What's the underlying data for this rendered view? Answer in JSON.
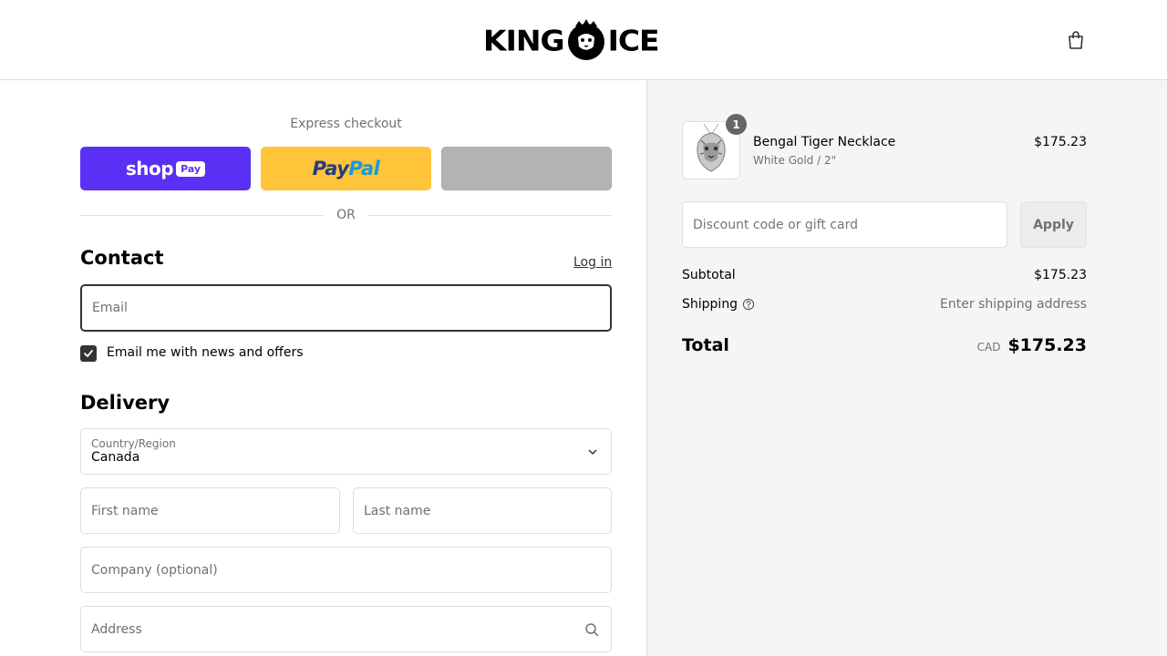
{
  "brand": {
    "name": "KING ICE",
    "left": "KING",
    "right": "ICE"
  },
  "header": {
    "cart_icon": "shopping-bag-icon"
  },
  "express": {
    "title": "Express checkout",
    "shoppay_word": "shop",
    "shoppay_badge": "Pay",
    "paypal_a": "Pay",
    "paypal_b": "Pal",
    "or": "OR"
  },
  "contact": {
    "title": "Contact",
    "login": "Log in",
    "email_placeholder": "Email",
    "newsletter_label": "Email me with news and offers",
    "newsletter_checked": true
  },
  "delivery": {
    "title": "Delivery",
    "country_label": "Country/Region",
    "country_value": "Canada",
    "first_name_placeholder": "First name",
    "last_name_placeholder": "Last name",
    "company_placeholder": "Company (optional)",
    "address_placeholder": "Address"
  },
  "summary": {
    "product": {
      "name": "Bengal Tiger Necklace",
      "variant": "White Gold / 2\"",
      "price": "$175.23",
      "quantity": "1"
    },
    "discount_placeholder": "Discount code or gift card",
    "apply_label": "Apply",
    "subtotal_label": "Subtotal",
    "subtotal_value": "$175.23",
    "shipping_label": "Shipping",
    "shipping_value": "Enter shipping address",
    "total_label": "Total",
    "total_currency": "CAD",
    "total_value": "$175.23"
  },
  "colors": {
    "shoppay": "#5a31f4",
    "paypal": "#ffc439",
    "gpay_placeholder": "#b3b3b3",
    "summary_bg": "#f5f5f5"
  }
}
